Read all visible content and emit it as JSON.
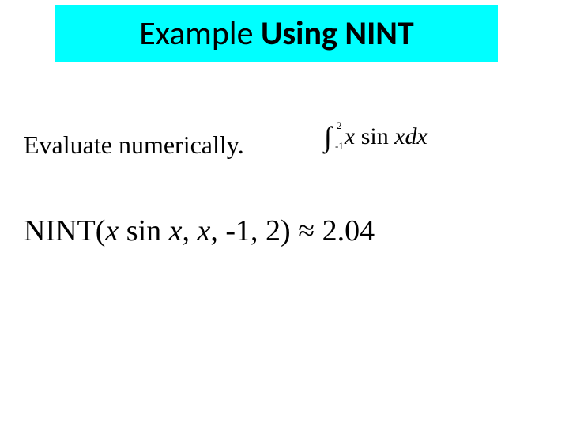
{
  "title": {
    "prefix": "Example ",
    "bold": "Using NINT"
  },
  "prompt": "Evaluate numerically.",
  "integral": {
    "upper": "2",
    "lower": "-1",
    "expr_x1": "x",
    "expr_sin": " sin ",
    "expr_x2": "xdx"
  },
  "result": {
    "func": "NINT(",
    "x1": "x",
    "sin": " sin ",
    "x2": "x",
    "comma1": ", ",
    "xvar": "x",
    "rest": ", -1, 2) ",
    "approx": "≈",
    "value": " 2.04"
  }
}
